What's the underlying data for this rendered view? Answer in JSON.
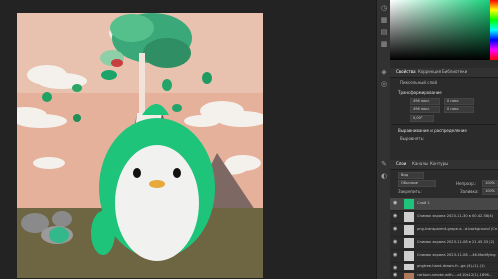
{
  "panels": {
    "properties_tabs": [
      "Свойства",
      "Коррекция",
      "Библиотеки"
    ],
    "properties_kind": "Пиксельный слой",
    "transform_label": "Трансформирование",
    "width_value": "496 пикс",
    "height_value": "496 пикс",
    "x_value": "0 пикс",
    "y_value": "0 пикс",
    "angle_value": "0,00°",
    "align_label": "Выравнивание и распределение",
    "align_sub": "Выровнять:"
  },
  "layers_panel": {
    "tabs": [
      "Слои",
      "Каналы",
      "Контуры"
    ],
    "filter_value": "Вид",
    "blend_mode": "Обычные",
    "opacity_label": "Непрозр.:",
    "opacity_value": "100%",
    "lock_label": "Закрепить:",
    "fill_label": "Заливка:",
    "fill_value": "100%",
    "layers": [
      {
        "name": "Слой 1",
        "selected": true
      },
      {
        "name": "Снимок экрана 2023-11-30 в 00.42.58(4)"
      },
      {
        "name": "png-transparent-grape-a...d-background (Сн...)"
      },
      {
        "name": "Снимок экрана 2023-11-08 в 21.45.33 (2)"
      },
      {
        "name": "Снимок экрана 2023-11-08 ...46-Modifying Photoshop"
      },
      {
        "name": "pngtree-hand-drawn-fr...ge-(4)-(1)-(1)"
      },
      {
        "name": "cartoon-smoke-with-...of-10x12(1)-1696..."
      }
    ]
  },
  "strip_icons": [
    "history-icon",
    "swatch-icon",
    "gradient-icon",
    "pattern-icon",
    "layers-icon",
    "channel-icon",
    "paths-icon",
    "adjust-icon"
  ],
  "colors": {
    "sky": "#e8b49a",
    "penguin_body": "#1ec47a",
    "volcano": "#6e5a58",
    "ground": "#6e6542",
    "panel_bg": "#2b2b2b",
    "canvas_bg": "#232323"
  }
}
